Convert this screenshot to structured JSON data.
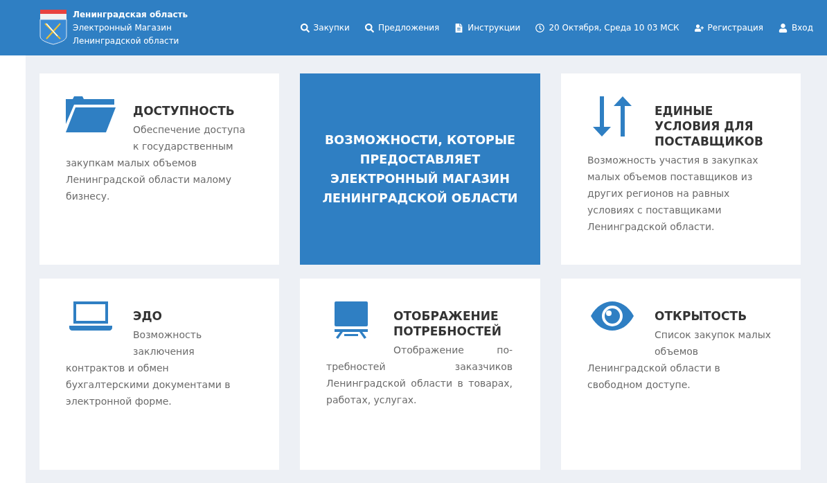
{
  "header": {
    "brand": {
      "title": "Ленинградская область",
      "subtitle_lines": [
        "Электронный Магазин",
        "Ленинградской области"
      ]
    },
    "nav": [
      {
        "label": "Закупки"
      },
      {
        "label": "Предложения"
      },
      {
        "label": "Инструкции"
      },
      {
        "label": "20 Октября, Среда 10 03 МСК"
      },
      {
        "label": "Регистрация"
      },
      {
        "label": "Вход"
      }
    ]
  },
  "cards": [
    {
      "kind": "feature",
      "title": "ДОСТУПНОСТЬ",
      "text": "Обеспечение доступа к государственным закупкам малых объемов Ленинградской области малому бизнесу.",
      "justified": false
    },
    {
      "kind": "highlight",
      "title": "ВОЗМОЖНОСТИ, КОТОРЫЕ ПРЕДОСТАВЛЯЕТ ЭЛЕКТРОННЫЙ МАГАЗИН ЛЕНИНГРАДСКОЙ ОБЛАСТИ"
    },
    {
      "kind": "feature",
      "title": "ЕДИНЫЕ УСЛОВИЯ ДЛЯ ПОСТАВЩИКОВ",
      "text": "Возможность участия в закупках малых объемов поставщиков из других регионов на равных условиях с поставщиками Ленинградской области.",
      "justified": false
    },
    {
      "kind": "feature",
      "title": "ЭДО",
      "text": "Возможность заключения контрактов и обмен бухгалтерскими документами в электронной форме.",
      "justified": false
    },
    {
      "kind": "feature",
      "title": "ОТОБРАЖЕНИЕ ПОТРЕБНОСТЕЙ",
      "text": "Отображение по-требностей заказчиков Ленинградской области в товарах, работах, услугах.",
      "justified": true
    },
    {
      "kind": "feature",
      "title": "ОТКРЫТОСТЬ",
      "text": "Список закупок малых объемов Ленинградской области в свободном доступе.",
      "justified": false
    }
  ]
}
